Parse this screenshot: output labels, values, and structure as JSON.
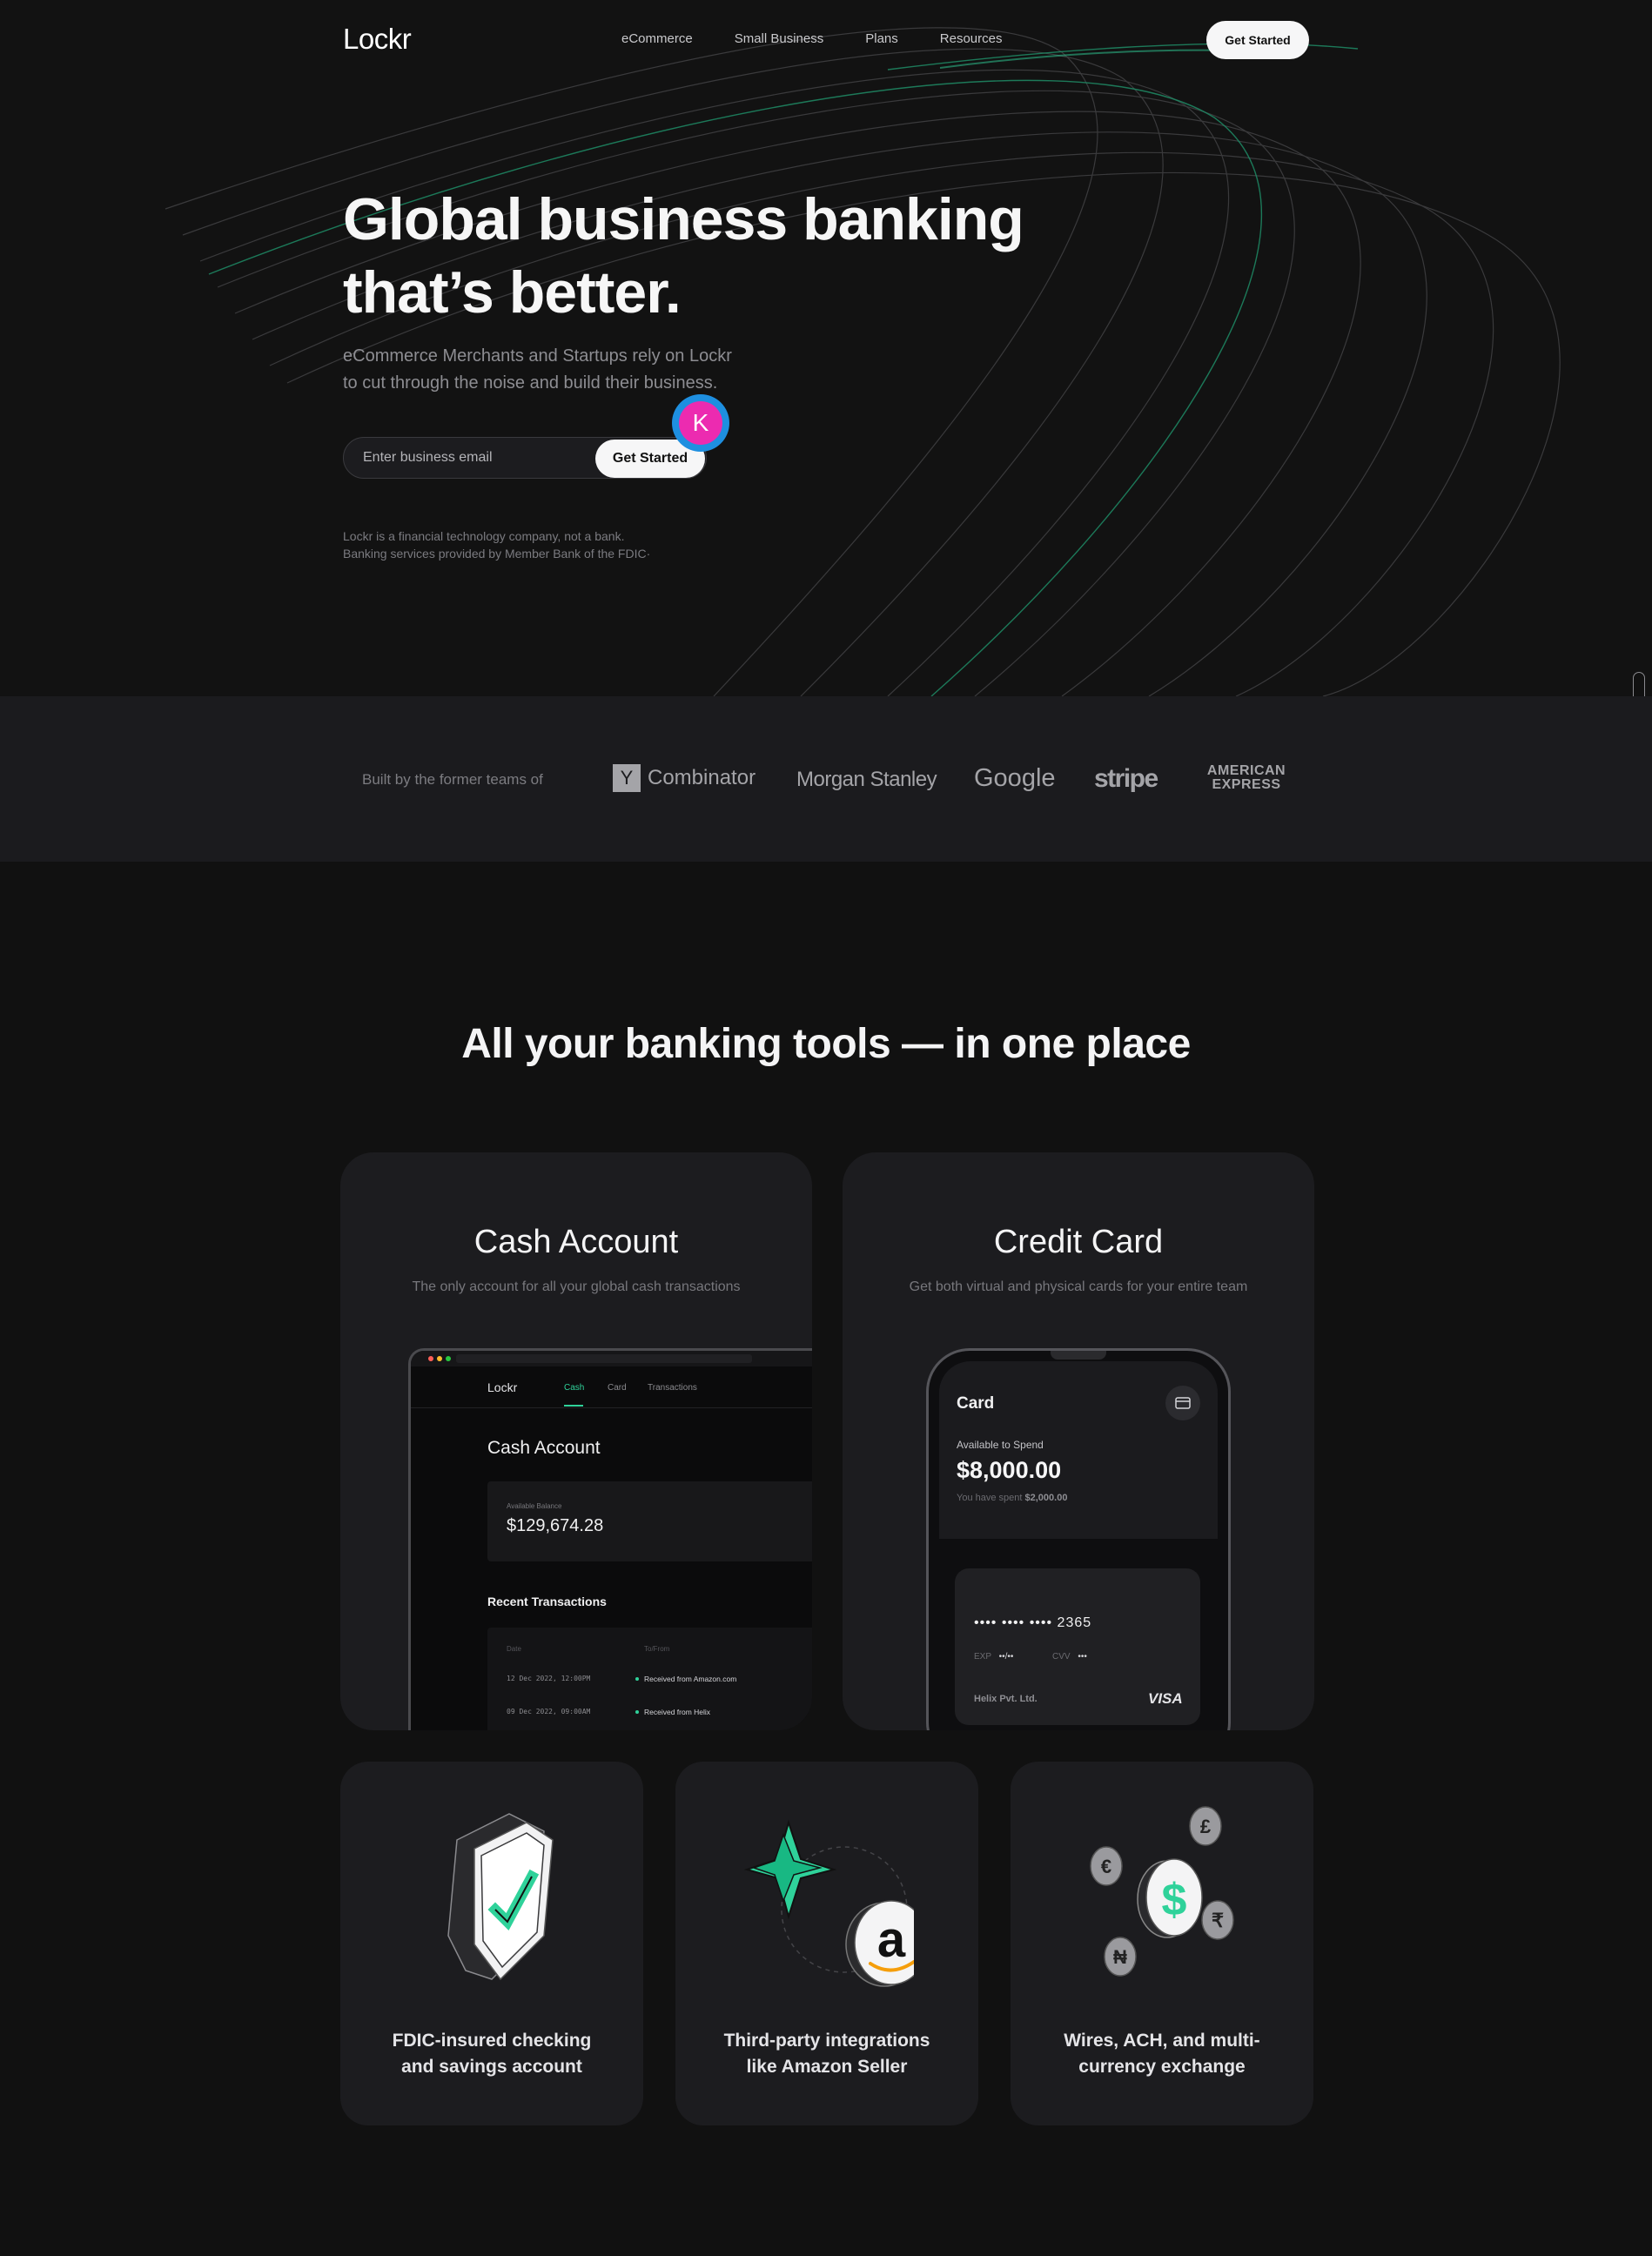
{
  "nav": {
    "logo": "Lockr",
    "links": [
      "eCommerce",
      "Small Business",
      "Plans",
      "Resources"
    ],
    "cta": "Get Started"
  },
  "hero": {
    "title_line1": "Global business banking",
    "title_line2": "that’s better.",
    "subtitle_line1": "eCommerce Merchants and Startups rely on Lockr",
    "subtitle_line2": "to cut through the noise and build their business.",
    "email_placeholder": "Enter business email",
    "email_value": "",
    "cta": "Get Started",
    "avatar_initial": "K",
    "disclaimer_line1": "Lockr is a financial technology company, not a bank.",
    "disclaimer_line2": "Banking services provided by Member Bank of the FDIC·"
  },
  "logos": {
    "label": "Built by the former teams of",
    "yc_mark": "Y",
    "yc_text": "Combinator",
    "morgan_stanley": "Morgan Stanley",
    "google": "Google",
    "stripe": "stripe",
    "amex_line1": "AMERICAN",
    "amex_line2": "EXPRESS"
  },
  "tools": {
    "title": "All your banking tools — in one place",
    "cash": {
      "title": "Cash Account",
      "subtitle": "The only account for all your global cash transactions",
      "app_logo": "Lockr",
      "tabs": [
        "Cash",
        "Card",
        "Transactions"
      ],
      "heading": "Cash Account",
      "balance_label": "Available Balance",
      "balance_value": "$129,674.28",
      "tx_heading": "Recent Transactions",
      "tx_col_date": "Date",
      "tx_col_from": "To/From",
      "transactions": [
        {
          "date": "12 Dec 2022, 12:00PM",
          "desc": "Received from Amazon.com"
        },
        {
          "date": "09 Dec 2022, 09:00AM",
          "desc": "Received from Helix"
        }
      ]
    },
    "credit": {
      "title": "Credit Card",
      "subtitle": "Get both virtual and physical cards for your entire team",
      "phone_title": "Card",
      "available_label": "Available to Spend",
      "available_amount": "$8,000.00",
      "spent_prefix": "You have spent",
      "spent_amount": "$2,000.00",
      "card_number": "•••• •••• •••• 2365",
      "exp_label": "EXP",
      "exp_value": "••/••",
      "cvv_label": "CVV",
      "cvv_value": "•••",
      "holder": "Helix Pvt. Ltd.",
      "network": "VISA"
    },
    "features": [
      {
        "line1": "FDIC-insured checking",
        "line2": "and savings account",
        "icon": "shield-check-icon"
      },
      {
        "line1": "Third-party integrations",
        "line2": "like Amazon Seller",
        "icon": "amazon-integration-icon"
      },
      {
        "line1": "Wires, ACH, and multi-",
        "line2": "currency exchange",
        "icon": "currency-coins-icon"
      }
    ],
    "coin_symbols": [
      "$",
      "€",
      "£",
      "₹",
      "₦"
    ],
    "amazon_mark": "a"
  },
  "colors": {
    "background": "#111111",
    "accent_green": "#2fd29a",
    "avatar_blue": "#1e8fe0",
    "avatar_pink": "#ec2bb0"
  }
}
